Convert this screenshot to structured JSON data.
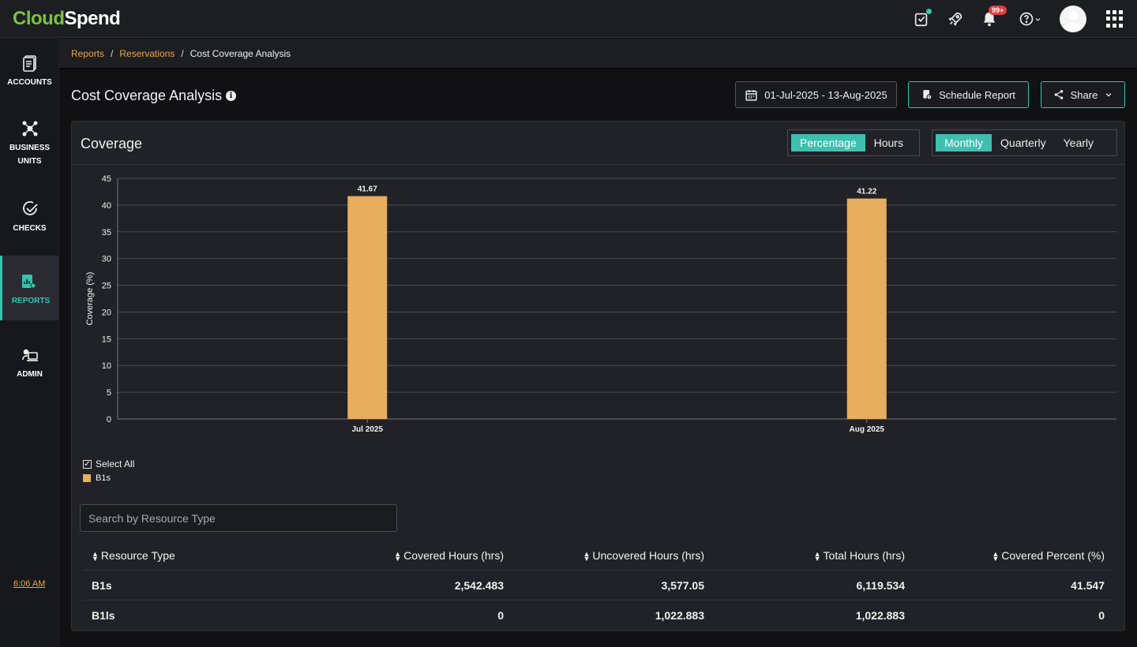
{
  "app": {
    "logo_part1": "Cloud",
    "logo_part2": "Spend"
  },
  "topbar": {
    "notif_count": "99+",
    "icons": [
      "checklist-icon",
      "rocket-icon",
      "bell-icon",
      "help-icon",
      "avatar",
      "apps-grid-icon"
    ]
  },
  "sidebar": {
    "items": [
      {
        "label": "ACCOUNTS",
        "icon": "accounts-icon"
      },
      {
        "label1": "BUSINESS",
        "label2": "UNITS",
        "icon": "business-units-icon"
      },
      {
        "label": "CHECKS",
        "icon": "checks-icon"
      },
      {
        "label": "REPORTS",
        "icon": "reports-icon",
        "active": true
      },
      {
        "label": "ADMIN",
        "icon": "admin-icon"
      }
    ],
    "time": "6:06 AM"
  },
  "breadcrumb": {
    "items": [
      "Reports",
      "Reservations"
    ],
    "current": "Cost Coverage Analysis"
  },
  "page": {
    "title": "Cost Coverage Analysis",
    "date_range": "01-Jul-2025 - 13-Aug-2025",
    "schedule_label": "Schedule Report",
    "share_label": "Share"
  },
  "card": {
    "title": "Coverage",
    "unit_toggle": [
      "Percentage",
      "Hours"
    ],
    "unit_selected": "Percentage",
    "period_toggle": [
      "Monthly",
      "Quarterly",
      "Yearly"
    ],
    "period_selected": "Monthly"
  },
  "chart_data": {
    "type": "bar",
    "categories": [
      "Jul 2025",
      "Aug 2025"
    ],
    "series": [
      {
        "name": "B1s",
        "values": [
          41.67,
          41.22
        ],
        "color": "#e6ae5e"
      }
    ],
    "data_labels": [
      "41.67",
      "41.22"
    ],
    "ylabel": "Coverage (%)",
    "xlabel": "",
    "ylim": [
      0,
      45
    ],
    "yticks": [
      0,
      5,
      10,
      15,
      20,
      25,
      30,
      35,
      40,
      45
    ],
    "grid": true,
    "legend_position": "bottom-left"
  },
  "legend": {
    "select_all": "Select All",
    "check_mark": "✓",
    "series_name": "B1s"
  },
  "search": {
    "placeholder": "Search by Resource Type"
  },
  "table": {
    "columns": [
      "Resource Type",
      "Covered Hours (hrs)",
      "Uncovered Hours (hrs)",
      "Total Hours (hrs)",
      "Covered Percent (%)"
    ],
    "rows": [
      [
        "B1s",
        "2,542.483",
        "3,577.05",
        "6,119.534",
        "41.547"
      ],
      [
        "B1ls",
        "0",
        "1,022.883",
        "1,022.883",
        "0"
      ]
    ]
  }
}
